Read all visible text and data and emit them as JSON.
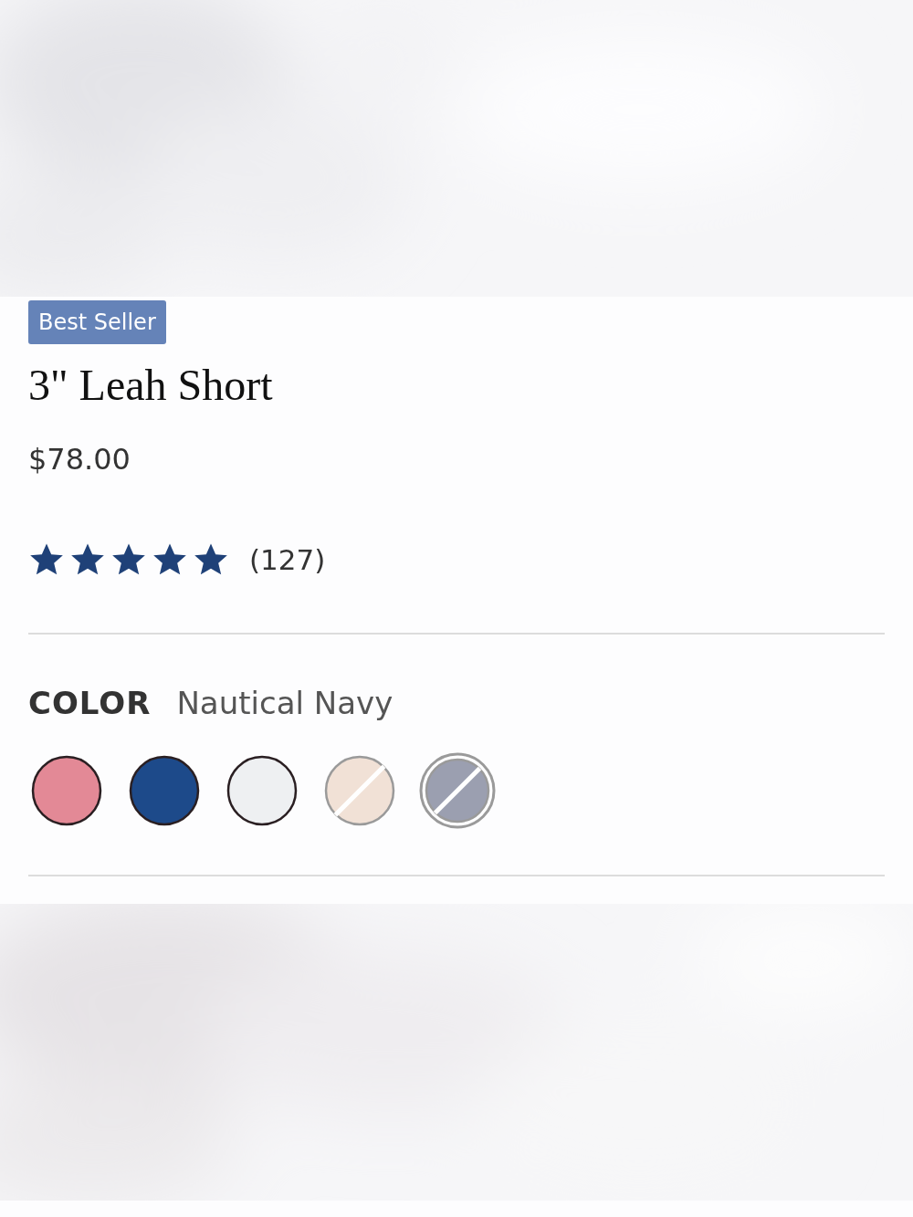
{
  "product": {
    "badge": "Best Seller",
    "title": "3\" Leah Short",
    "price": "$78.00",
    "rating": {
      "stars": 5,
      "count": "(127)"
    }
  },
  "color": {
    "label": "COLOR",
    "value": "Nautical Navy",
    "swatches": [
      {
        "color": "#e38996",
        "available": true,
        "selected": false
      },
      {
        "color": "#1d4a8a",
        "available": true,
        "selected": false
      },
      {
        "color": "#eef0f2",
        "available": true,
        "selected": false
      },
      {
        "color": "#f1e1d6",
        "available": false,
        "selected": false
      },
      {
        "color": "#9b9fb0",
        "available": false,
        "selected": true
      }
    ]
  }
}
